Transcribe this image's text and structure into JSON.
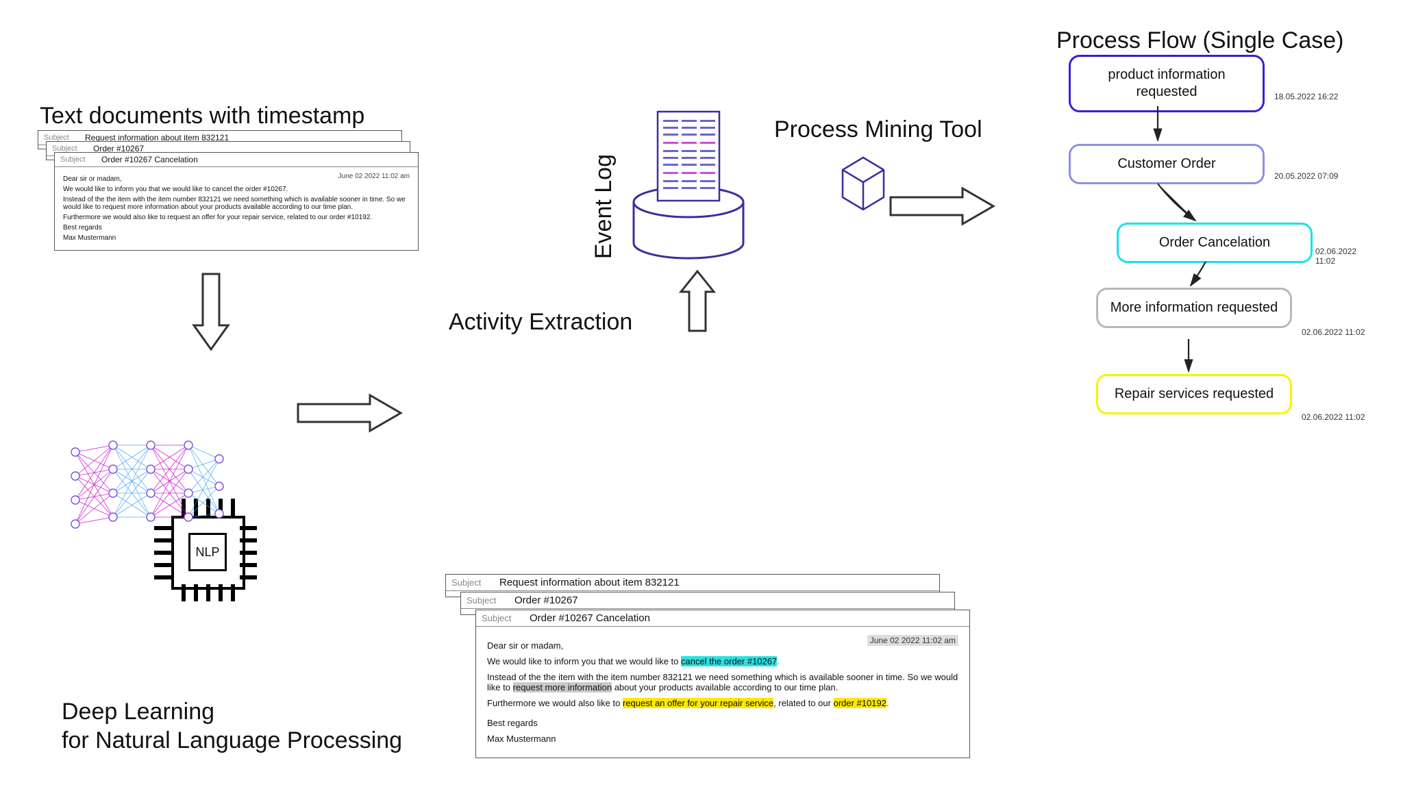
{
  "titles": {
    "text_docs": "Text documents with timestamp",
    "activity_extraction": "Activity Extraction",
    "event_log": "Event Log",
    "process_mining_tool": "Process Mining Tool",
    "process_flow": "Process Flow (Single Case)",
    "deep_learning_1": "Deep Learning",
    "deep_learning_2": "for Natural Language Processing"
  },
  "labels": {
    "subject": "Subject",
    "nlp": "NLP"
  },
  "emails": {
    "stack1": {
      "back": {
        "subject": "Request information about item 832121"
      },
      "mid": {
        "subject": "Order #10267"
      },
      "front": {
        "subject": "Order #10267 Cancelation",
        "date": "June 02 2022 11:02 am",
        "greeting": "Dear sir or madam,",
        "p1": "We would like to inform you that we would like to cancel the order #10267.",
        "p2": "Instead of the the item with the item number 832121 we need something which is available sooner in time. So we would like to request more information about your products available according to our time plan.",
        "p3": "Furthermore we would also like to request an offer for your repair service, related to our order #10192.",
        "regards": "Best regards",
        "signature": "Max Mustermann"
      }
    },
    "stack2": {
      "back": {
        "subject": "Request information about item 832121"
      },
      "mid": {
        "subject": "Order #10267"
      },
      "front": {
        "subject": "Order #10267 Cancelation",
        "date": "June 02 2022 11:02 am",
        "greeting": "Dear sir or madam,",
        "p1_a": "We would like to inform you that we would like to ",
        "p1_hl": "cancel the order #10267",
        "p1_b": ".",
        "p2_a": "Instead of the the item with the item number 832121 we need something which is available sooner in time. So we would like to ",
        "p2_hl": "request more information",
        "p2_b": " about your products available according to our time plan.",
        "p3_a": "Furthermore we would also like to ",
        "p3_hl1": "request an offer for your repair service",
        "p3_b": ", related to our ",
        "p3_hl2": "order #10192",
        "p3_c": ".",
        "regards": "Best regards",
        "signature": "Max Mustermann"
      }
    }
  },
  "process_flow": {
    "nodes": [
      {
        "label": "product information requested",
        "color": "#3a1fd6",
        "ts": "18.05.2022 16:22"
      },
      {
        "label": "Customer Order",
        "color": "#8f8fe6",
        "ts": "20.05.2022 07:09"
      },
      {
        "label": "Order Cancelation",
        "color": "#18e2e8",
        "ts": "02.06.2022 11:02"
      },
      {
        "label": "More information requested",
        "color": "#b8b8b8",
        "ts": "02.06.2022 11:02"
      },
      {
        "label": "Repair services requested",
        "color": "#f5f500",
        "ts": "02.06.2022 11:02"
      }
    ]
  }
}
